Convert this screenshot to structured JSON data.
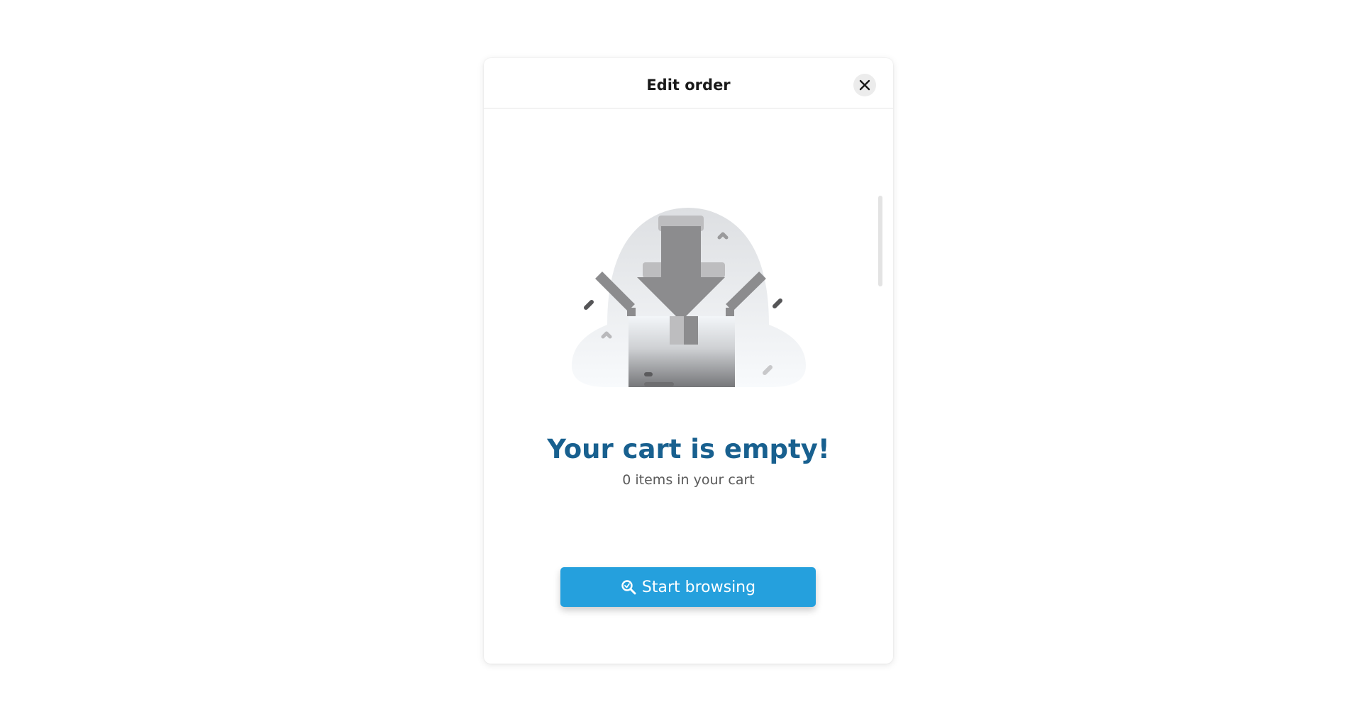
{
  "modal": {
    "title": "Edit order",
    "close_icon": "close-icon"
  },
  "empty_state": {
    "illustration": "empty-box-illustration",
    "title": "Your cart is empty!",
    "subtitle": "0 items in your cart"
  },
  "actions": {
    "browse_label": "Start browsing",
    "browse_icon": "search-icon"
  },
  "colors": {
    "title": "#18608f",
    "button": "#25a0dd",
    "subtitle": "#5a5a5a"
  }
}
